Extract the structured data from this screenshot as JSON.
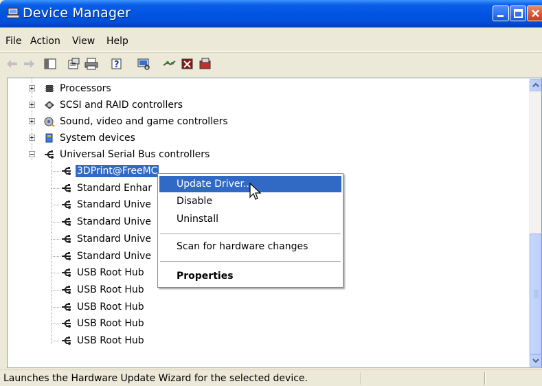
{
  "window": {
    "title": "Device Manager"
  },
  "menu": [
    "File",
    "Action",
    "View",
    "Help"
  ],
  "toolbar": {
    "buttons": [
      "back-icon",
      "forward-icon",
      "console-tree-icon",
      "properties-icon",
      "print-icon",
      "help-icon",
      "scan-hardware-icon",
      "update-driver-icon",
      "uninstall-icon",
      "disable-icon"
    ]
  },
  "tree": {
    "categories": [
      {
        "label": "Processors",
        "icon": "processor-icon",
        "expanded": false
      },
      {
        "label": "SCSI and RAID controllers",
        "icon": "scsi-icon",
        "expanded": false
      },
      {
        "label": "Sound, video and game controllers",
        "icon": "sound-icon",
        "expanded": false
      },
      {
        "label": "System devices",
        "icon": "system-icon",
        "expanded": false
      },
      {
        "label": "Universal Serial Bus controllers",
        "icon": "usb-icon",
        "expanded": true
      }
    ],
    "usb_children": [
      "3DPrint@FreeMC",
      "Standard Enhar",
      "Standard Unive",
      "Standard Unive",
      "Standard Unive",
      "Standard Unive",
      "USB Root Hub",
      "USB Root Hub",
      "USB Root Hub",
      "USB Root Hub",
      "USB Root Hub"
    ]
  },
  "context_menu": {
    "update_driver": "Update Driver...",
    "disable": "Disable",
    "uninstall": "Uninstall",
    "scan": "Scan for hardware changes",
    "properties": "Properties"
  },
  "status": {
    "text": "Launches the Hardware Update Wizard for the selected device."
  },
  "colors": {
    "selection": "#316ac5",
    "title_blue": "#0054e3"
  }
}
